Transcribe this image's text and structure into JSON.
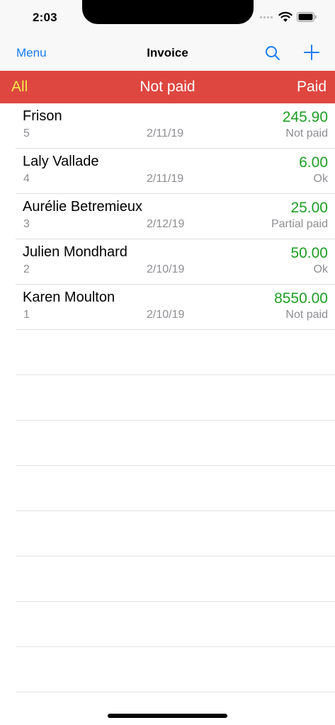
{
  "status_bar": {
    "time": "2:03"
  },
  "nav": {
    "menu_label": "Menu",
    "title": "Invoice"
  },
  "segments": {
    "all": "All",
    "not_paid": "Not paid",
    "paid": "Paid"
  },
  "invoices": [
    {
      "name": "Frison",
      "number": "5",
      "date": "2/11/19",
      "amount": "245.90",
      "status": "Not paid"
    },
    {
      "name": "Laly Vallade",
      "number": "4",
      "date": "2/11/19",
      "amount": "6.00",
      "status": "Ok"
    },
    {
      "name": "Aurélie Betremieux",
      "number": "3",
      "date": "2/12/19",
      "amount": "25.00",
      "status": "Partial paid"
    },
    {
      "name": "Julien Mondhard",
      "number": "2",
      "date": "2/10/19",
      "amount": "50.00",
      "status": "Ok"
    },
    {
      "name": "Karen Moulton",
      "number": "1",
      "date": "2/10/19",
      "amount": "8550.00",
      "status": "Not paid"
    }
  ],
  "colors": {
    "accent": "#1a7cf5",
    "segment_bar": "#de4740",
    "segment_selected": "#f5e84a",
    "amount": "#1e9e24",
    "secondary_text": "#8e8e93"
  },
  "icons": {
    "search": "search-icon",
    "add": "plus-icon",
    "wifi": "wifi-icon",
    "battery": "battery-icon",
    "signal": "cellular-signal-icon"
  }
}
